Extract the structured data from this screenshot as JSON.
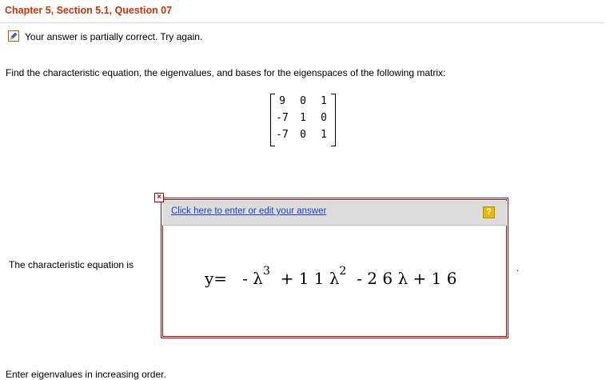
{
  "header": {
    "title": "Chapter 5, Section 5.1, Question 07"
  },
  "status": {
    "icon": "pencil-icon",
    "text": "Your answer is partially correct.  Try again."
  },
  "question": {
    "prompt": "Find the characteristic equation, the eigenvalues, and bases for the eigenspaces of the following matrix:",
    "matrix": [
      [
        "9",
        "0",
        "1"
      ],
      [
        "-7",
        "1",
        "0"
      ],
      [
        "-7",
        "0",
        "1"
      ]
    ]
  },
  "answer": {
    "label": "The characteristic equation is",
    "edit_link": "Click here to enter or edit your answer",
    "help_label": "?",
    "close_label": "×",
    "equation": {
      "lhs": "y=",
      "t1": "-  λ",
      "p1": "3",
      "t2": "+ 1 1 λ",
      "p2": "2",
      "t3": "-  2 6 λ  + 1 6"
    },
    "trailing": "."
  },
  "next": {
    "prompt": "Enter eigenvalues in increasing order."
  },
  "colors": {
    "title": "#cc3300",
    "box_border": "#cc0000",
    "link": "#1a3ec8",
    "help": "#e8b800"
  }
}
